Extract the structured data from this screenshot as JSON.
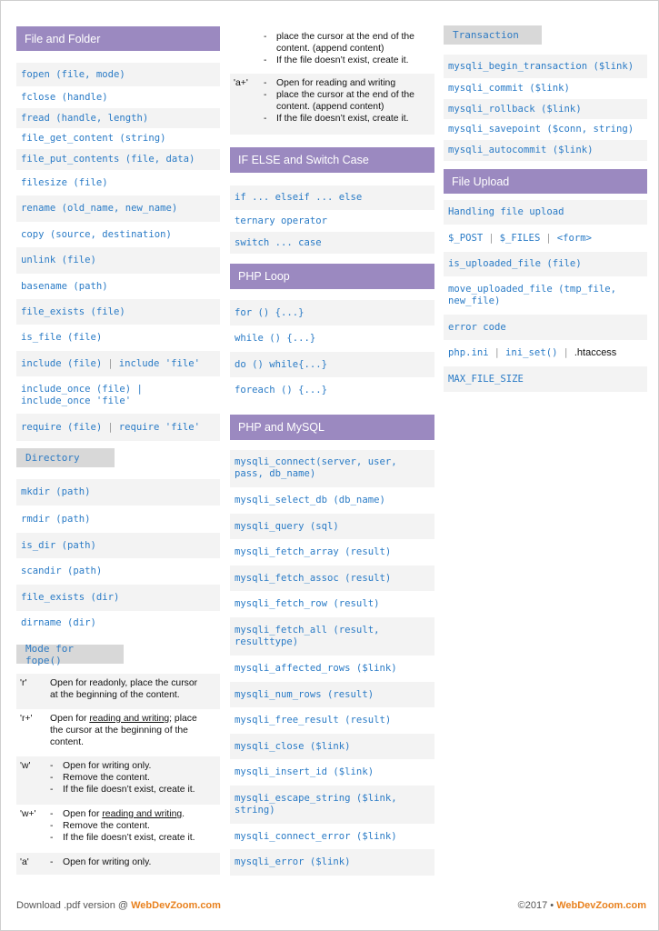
{
  "file_folder": {
    "title": "File and Folder",
    "items": [
      "fopen (file, mode)",
      "fclose (handle)",
      "fread (handle, length)",
      "file_get_content (string)",
      "file_put_contents (file, data)",
      "filesize (file)",
      "rename (old_name, new_name)",
      "copy (source, destination)",
      "unlink (file)",
      "basename (path)",
      "file_exists (file)",
      "is_file (file)"
    ],
    "include": [
      "include (file)",
      "include 'file'"
    ],
    "include_once": [
      "include_once (file) |",
      "include_once 'file'"
    ],
    "require": [
      "require (file)",
      "require 'file'"
    ]
  },
  "directory": {
    "title": "Directory",
    "items": [
      "mkdir (path)",
      "rmdir (path)",
      "is_dir (path)",
      "scandir (path)",
      "file_exists (dir)",
      "dirname (dir)"
    ]
  },
  "modes": {
    "title": "Mode for fope()",
    "r": {
      "key": "'r'",
      "line1": "Open for readonly, place the cursor",
      "line2": "at the beginning of the content."
    },
    "r_plus": {
      "key": "'r+'",
      "a": "Open for ",
      "u": "reading and writing",
      "b": "; place",
      "line2": "the cursor  at the beginning of the",
      "line3": "content."
    },
    "w": {
      "key": "'w'",
      "b1": "Open for writing only.",
      "b2": "Remove the content.",
      "b3": "If the file doesn’t exist, create it."
    },
    "w_plus": {
      "key": "'w+'",
      "a": "Open for ",
      "u": "reading and writing",
      "b": ".",
      "b2": "Remove the content.",
      "b3": "If the file doesn’t exist, create it."
    },
    "a": {
      "key": "'a'",
      "b1": "Open for writing only."
    },
    "a_cont": {
      "b1": "place the cursor at the end of the",
      "b1b": "content. (append content)",
      "b2": "If the file doesn’t exist, create it."
    },
    "a_plus": {
      "key": "'a+'",
      "b1": "Open for reading and writing",
      "b2": "place the cursor at the end of the",
      "b2b": "content. (append content)",
      "b3": "If the file doesn’t exist, create it."
    },
    "dash": "-"
  },
  "ifelse": {
    "title": "IF ELSE and Switch Case",
    "items": [
      "if ... elseif ... else",
      "ternary operator",
      "switch ... case"
    ]
  },
  "loop": {
    "title": "PHP Loop",
    "items": [
      "for () {...}",
      "while () {...}",
      "do () while{...}",
      "foreach () {...}"
    ]
  },
  "mysql": {
    "title": "PHP and MySQL",
    "connect": [
      "mysqli_connect(server, user,",
      "pass, db_name)"
    ],
    "items1": [
      "mysqli_select_db (db_name)",
      "mysqli_query (sql)",
      "mysqli_fetch_array (result)",
      "mysqli_fetch_assoc (result)",
      "mysqli_fetch_row (result)"
    ],
    "fetch_all": [
      "mysqli_fetch_all (result,",
      "resulttype)"
    ],
    "items2": [
      "mysqli_affected_rows ($link)",
      "mysqli_num_rows (result)",
      "mysqli_free_result (result)",
      "mysqli_close ($link)",
      "mysqli_insert_id ($link)"
    ],
    "escape": [
      "mysqli_escape_string ($link,",
      "string)"
    ],
    "items3": [
      "mysqli_connect_error ($link)",
      "mysqli_error ($link)"
    ]
  },
  "transaction": {
    "title": "Transaction",
    "items": [
      "mysqli_begin_transaction ($link)",
      "mysqli_commit ($link)",
      "mysqli_rollback ($link)",
      "mysqli_savepoint ($conn, string)",
      "mysqli_autocommit ($link)"
    ]
  },
  "upload": {
    "title": "File Upload",
    "handling": "Handling file upload",
    "vars": [
      "$_POST",
      "$_FILES",
      "<form>"
    ],
    "is_uploaded": "is_uploaded_file (file)",
    "move": [
      "move_uploaded_file (tmp_file,",
      "new_file)"
    ],
    "error": "error code",
    "ini": [
      "php.ini",
      "ini_set()",
      ".htaccess"
    ],
    "max": "MAX_FILE_SIZE",
    "pipe": "|"
  },
  "footer": {
    "left_text": "Download .pdf version @ ",
    "left_brand": "WebDevZoom.com",
    "right_text": "©2017 • ",
    "right_brand": "WebDevZoom.com"
  },
  "colors": {
    "header_purple": "#9b89c0",
    "header_gray": "#d8d8d8",
    "code_blue": "#2a7bc6",
    "brand_orange": "#e8811e"
  }
}
